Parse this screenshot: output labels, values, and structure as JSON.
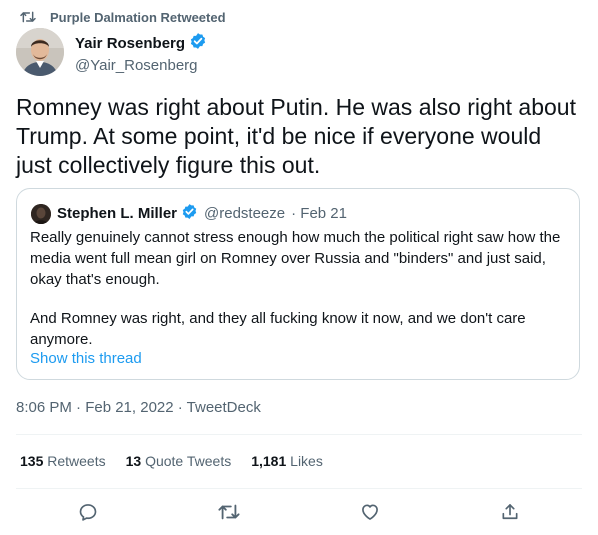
{
  "retweet": {
    "label": "Purple Dalmation Retweeted",
    "icon": "retweet-icon"
  },
  "tweet": {
    "author_name": "Yair Rosenberg",
    "author_handle": "@Yair_Rosenberg",
    "verified_icon": "verified-badge-icon",
    "text": "Romney was right about Putin. He was also right about Trump. At some point, it'd be nice if everyone would just collectively figure this out.",
    "timestamp": "8:06 PM · Feb 21, 2022 · TweetDeck"
  },
  "quote": {
    "author_name": "Stephen L. Miller",
    "author_handle": "@redsteeze",
    "date": "· Feb 21",
    "paragraph1": "Really genuinely cannot stress enough how much the political right saw how the media went full mean girl on Romney over Russia and \"binders\" and just said, okay that's enough.",
    "paragraph2": "And Romney was right, and they all fucking know it now, and we don't care anymore.",
    "show_thread": "Show this thread"
  },
  "stats": {
    "retweets_count": "135",
    "retweets_label": "Retweets",
    "quotes_count": "13",
    "quotes_label": "Quote Tweets",
    "likes_count": "1,181",
    "likes_label": "Likes"
  },
  "actions": [
    "reply-icon",
    "retweet-icon",
    "like-icon",
    "share-icon"
  ],
  "colors": {
    "accent": "#1d9bf0",
    "text": "#0f1419",
    "secondary": "#536471",
    "border": "#cfd9de"
  }
}
